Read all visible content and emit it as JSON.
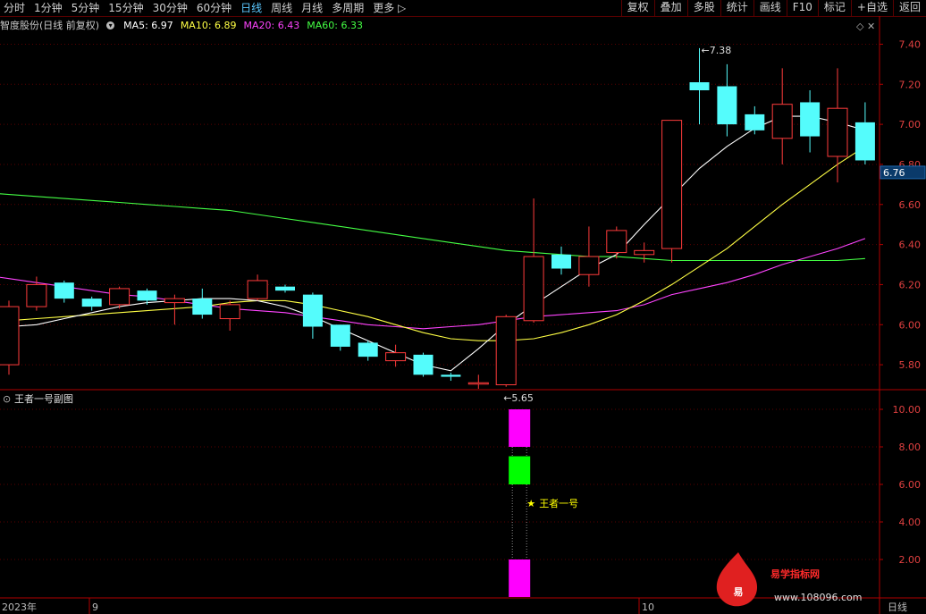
{
  "toolbar": {
    "periods": [
      "分时",
      "1分钟",
      "5分钟",
      "15分钟",
      "30分钟",
      "60分钟",
      "日线",
      "周线",
      "月线",
      "多周期",
      "更多 ▷"
    ],
    "active_period": "日线",
    "right_buttons": [
      "复权",
      "叠加",
      "多股",
      "统计",
      "画线",
      "F10",
      "标记",
      "+自选",
      "返回"
    ]
  },
  "info": {
    "stock": "智度股份(日线 前复权)",
    "ma5": "MA5: 6.97",
    "ma10": "MA10: 6.89",
    "ma20": "MA20: 6.43",
    "ma60": "MA60: 6.33"
  },
  "colors": {
    "up": "#ff3b3b",
    "down": "#54fcfc",
    "ma5": "#ffffff",
    "ma10": "#ffff44",
    "ma20": "#ff44ff",
    "ma60": "#44ff44",
    "grid": "#5a0000",
    "axis": "#b00000"
  },
  "sub": {
    "title": "王者一号副图",
    "signal_label": "王者一号"
  },
  "bottom": {
    "year_label": "2023年",
    "month_9": "9",
    "month_10": "10",
    "period_label": "日线"
  },
  "watermark": {
    "logo_char": "易",
    "name": "易学指标网",
    "url": "www.108096.com"
  },
  "chart_data": {
    "type": "candlestick",
    "main_y_ticks": [
      "7.40",
      "7.20",
      "7.00",
      "6.80",
      "6.60",
      "6.40",
      "6.20",
      "6.00",
      "5.80"
    ],
    "main_ylim": [
      5.68,
      7.46
    ],
    "current_price": "6.76",
    "high_label": "7.38",
    "low_label": "5.65",
    "candles": [
      {
        "o": 5.8,
        "c": 6.09,
        "h": 6.12,
        "l": 5.75
      },
      {
        "o": 6.09,
        "c": 6.2,
        "h": 6.24,
        "l": 6.07
      },
      {
        "o": 6.21,
        "c": 6.13,
        "h": 6.22,
        "l": 6.11
      },
      {
        "o": 6.13,
        "c": 6.09,
        "h": 6.14,
        "l": 6.07
      },
      {
        "o": 6.1,
        "c": 6.18,
        "h": 6.19,
        "l": 6.08
      },
      {
        "o": 6.17,
        "c": 6.12,
        "h": 6.18,
        "l": 6.1
      },
      {
        "o": 6.11,
        "c": 6.13,
        "h": 6.15,
        "l": 6.0
      },
      {
        "o": 6.13,
        "c": 6.05,
        "h": 6.18,
        "l": 6.03
      },
      {
        "o": 6.03,
        "c": 6.1,
        "h": 6.12,
        "l": 5.97
      },
      {
        "o": 6.13,
        "c": 6.22,
        "h": 6.25,
        "l": 6.12
      },
      {
        "o": 6.19,
        "c": 6.17,
        "h": 6.2,
        "l": 6.16
      },
      {
        "o": 6.15,
        "c": 5.99,
        "h": 6.16,
        "l": 5.93
      },
      {
        "o": 6.0,
        "c": 5.89,
        "h": 6.0,
        "l": 5.87
      },
      {
        "o": 5.91,
        "c": 5.84,
        "h": 5.92,
        "l": 5.82
      },
      {
        "o": 5.82,
        "c": 5.86,
        "h": 5.9,
        "l": 5.79
      },
      {
        "o": 5.85,
        "c": 5.75,
        "h": 5.86,
        "l": 5.74
      },
      {
        "o": 5.75,
        "c": 5.74,
        "h": 5.76,
        "l": 5.72
      },
      {
        "o": 5.71,
        "c": 5.71,
        "h": 5.75,
        "l": 5.68
      },
      {
        "o": 5.7,
        "c": 6.04,
        "h": 6.05,
        "l": 5.69
      },
      {
        "o": 6.02,
        "c": 6.34,
        "h": 6.63,
        "l": 6.01
      },
      {
        "o": 6.35,
        "c": 6.28,
        "h": 6.39,
        "l": 6.25
      },
      {
        "o": 6.25,
        "c": 6.34,
        "h": 6.49,
        "l": 6.19
      },
      {
        "o": 6.36,
        "c": 6.47,
        "h": 6.49,
        "l": 6.33
      },
      {
        "o": 6.35,
        "c": 6.37,
        "h": 6.41,
        "l": 6.31
      },
      {
        "o": 6.38,
        "c": 7.02,
        "h": 7.02,
        "l": 6.31
      },
      {
        "o": 7.21,
        "c": 7.17,
        "h": 7.38,
        "l": 7.0
      },
      {
        "o": 7.19,
        "c": 7.0,
        "h": 7.3,
        "l": 6.94
      },
      {
        "o": 7.05,
        "c": 6.97,
        "h": 7.09,
        "l": 6.95
      },
      {
        "o": 6.93,
        "c": 7.1,
        "h": 7.28,
        "l": 6.8
      },
      {
        "o": 7.11,
        "c": 6.94,
        "h": 7.17,
        "l": 6.86
      },
      {
        "o": 6.84,
        "c": 7.08,
        "h": 7.28,
        "l": 6.71
      },
      {
        "o": 7.01,
        "c": 6.82,
        "h": 7.11,
        "l": 6.8
      }
    ],
    "ma5": [
      5.93,
      5.96,
      5.99,
      6.0,
      6.03,
      6.06,
      6.09,
      6.11,
      6.12,
      6.13,
      6.13,
      6.12,
      6.09,
      6.04,
      5.98,
      5.92,
      5.86,
      5.8,
      5.77,
      5.88,
      6.0,
      6.1,
      6.19,
      6.28,
      6.35,
      6.5,
      6.64,
      6.78,
      6.89,
      6.98,
      7.04,
      7.04,
      7.01,
      6.97
    ],
    "ma10": [
      6.01,
      6.01,
      6.02,
      6.03,
      6.04,
      6.05,
      6.06,
      6.07,
      6.08,
      6.09,
      6.11,
      6.12,
      6.12,
      6.1,
      6.07,
      6.04,
      6.0,
      5.96,
      5.93,
      5.92,
      5.92,
      5.93,
      5.96,
      6.0,
      6.05,
      6.12,
      6.2,
      6.29,
      6.38,
      6.49,
      6.6,
      6.7,
      6.8,
      6.89
    ],
    "ma20": [
      6.27,
      6.25,
      6.23,
      6.21,
      6.19,
      6.17,
      6.15,
      6.14,
      6.12,
      6.1,
      6.08,
      6.07,
      6.06,
      6.04,
      6.02,
      6.0,
      5.99,
      5.98,
      5.99,
      6.0,
      6.02,
      6.04,
      6.05,
      6.06,
      6.07,
      6.1,
      6.15,
      6.18,
      6.21,
      6.25,
      6.3,
      6.34,
      6.38,
      6.43
    ],
    "ma60": [
      6.67,
      6.66,
      6.65,
      6.64,
      6.63,
      6.62,
      6.61,
      6.6,
      6.59,
      6.58,
      6.57,
      6.55,
      6.53,
      6.51,
      6.49,
      6.47,
      6.45,
      6.43,
      6.41,
      6.39,
      6.37,
      6.36,
      6.35,
      6.34,
      6.34,
      6.33,
      6.32,
      6.32,
      6.32,
      6.32,
      6.32,
      6.32,
      6.32,
      6.33
    ],
    "sub_y_ticks": [
      "10.00",
      "8.00",
      "6.00",
      "4.00",
      "2.00"
    ],
    "sub_ylim": [
      0,
      11
    ],
    "sub_bars": [
      {
        "idx": 18,
        "from": 8.0,
        "to": 10.0,
        "color": "#ff00ff"
      },
      {
        "idx": 18,
        "from": 6.0,
        "to": 7.5,
        "color": "#00ff00"
      },
      {
        "idx": 18,
        "from": 0.0,
        "to": 2.0,
        "color": "#ff00ff"
      }
    ]
  }
}
